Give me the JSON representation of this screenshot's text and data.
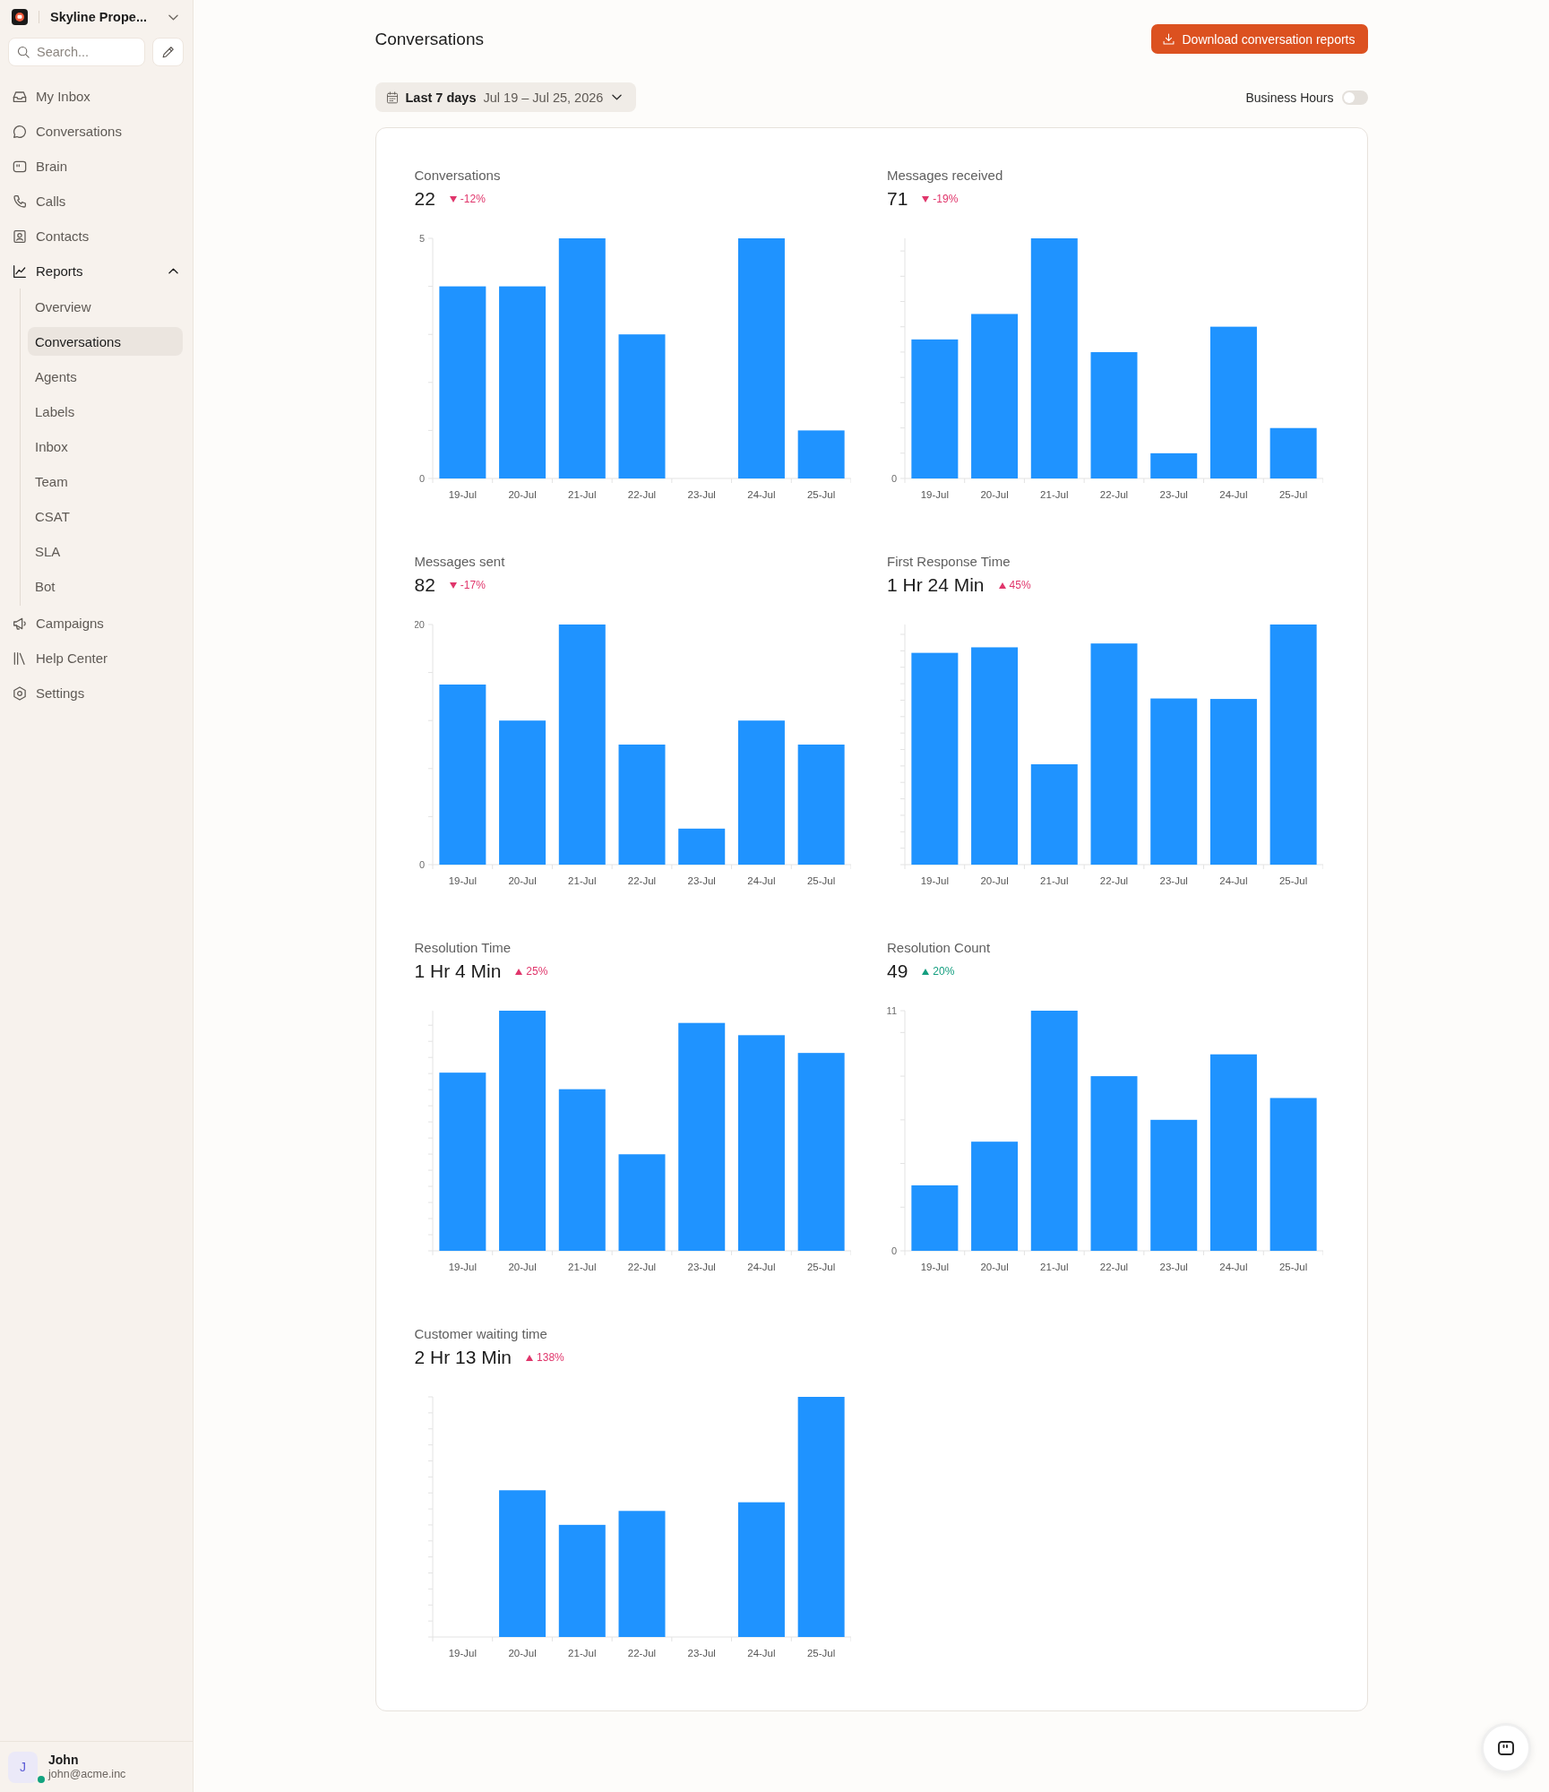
{
  "sidebar": {
    "workspace": "Skyline Prope...",
    "search": {
      "placeholder": "Search..."
    },
    "nav": [
      {
        "label": "My Inbox",
        "selected": false
      },
      {
        "label": "Conversations",
        "selected": false
      },
      {
        "label": "Brain",
        "selected": false
      },
      {
        "label": "Calls",
        "selected": false
      },
      {
        "label": "Contacts",
        "selected": false
      },
      {
        "label": "Reports",
        "selected": false,
        "expanded": true,
        "children": [
          {
            "label": "Overview",
            "selected": false
          },
          {
            "label": "Conversations",
            "selected": true
          },
          {
            "label": "Agents",
            "selected": false
          },
          {
            "label": "Labels",
            "selected": false
          },
          {
            "label": "Inbox",
            "selected": false
          },
          {
            "label": "Team",
            "selected": false
          },
          {
            "label": "CSAT",
            "selected": false
          },
          {
            "label": "SLA",
            "selected": false
          },
          {
            "label": "Bot",
            "selected": false
          }
        ]
      },
      {
        "label": "Campaigns",
        "selected": false
      },
      {
        "label": "Help Center",
        "selected": false
      },
      {
        "label": "Settings",
        "selected": false
      }
    ],
    "user": {
      "initial": "J",
      "name": "John",
      "email": "john@acme.inc",
      "online": true
    }
  },
  "header": {
    "title": "Conversations",
    "download_button": "Download conversation reports",
    "date_range": {
      "preset": "Last 7 days",
      "range": "Jul 19 – Jul 25, 2026"
    },
    "business_hours": {
      "label": "Business Hours",
      "on": false
    }
  },
  "metrics": [
    {
      "title": "Conversations",
      "value": "22",
      "change": "-12%",
      "increase": false,
      "favorable": false,
      "chart_data": {
        "type": "bar",
        "categories": [
          "19-Jul",
          "20-Jul",
          "21-Jul",
          "22-Jul",
          "23-Jul",
          "24-Jul",
          "25-Jul"
        ],
        "values": [
          4,
          4,
          5,
          3,
          0,
          5,
          1
        ],
        "ylim": [
          0,
          5
        ],
        "yticks": [
          0,
          5
        ]
      }
    },
    {
      "title": "Messages received",
      "value": "71",
      "change": "-19%",
      "increase": false,
      "favorable": false,
      "chart": {
        "x_labels": [
          "19-Jul",
          "20-Jul",
          "21-Jul",
          "22-Jul",
          "23-Jul",
          "24-Jul",
          "25-Jul"
        ],
        "y_labels": [
          "0"
        ]
      }
    },
    {
      "title": "Messages sent",
      "value": "82",
      "change": "-17%",
      "increase": false,
      "favorable": false,
      "chart_data": {
        "type": "bar",
        "categories": [
          "19-Jul",
          "20-Jul",
          "21-Jul",
          "22-Jul",
          "23-Jul",
          "24-Jul",
          "25-Jul"
        ],
        "values": [
          15,
          12,
          20,
          10,
          3,
          12,
          10
        ],
        "ylim": [
          0,
          20
        ],
        "yticks": [
          0,
          20
        ]
      }
    },
    {
      "title": "First Response Time",
      "value": "1 Hr 24 Min",
      "change": "45%",
      "increase": true,
      "favorable": false,
      "chart": {
        "x_labels": [
          "19-Jul",
          "20-Jul",
          "21-Jul",
          "22-Jul",
          "23-Jul",
          "24-Jul",
          "25-Jul"
        ]
      }
    },
    {
      "title": "Resolution Time",
      "value": "1 Hr 4 Min",
      "change": "25%",
      "increase": true,
      "favorable": false,
      "chart": {
        "x_labels": [
          "19-Jul",
          "20-Jul",
          "21-Jul",
          "22-Jul",
          "23-Jul",
          "24-Jul",
          "25-Jul"
        ]
      }
    },
    {
      "title": "Resolution Count",
      "value": "49",
      "change": "20%",
      "increase": true,
      "favorable": true,
      "chart_data": {
        "type": "bar",
        "categories": [
          "19-Jul",
          "20-Jul",
          "21-Jul",
          "22-Jul",
          "23-Jul",
          "24-Jul",
          "25-Jul"
        ],
        "values": [
          3,
          5,
          11,
          8,
          6,
          9,
          7
        ],
        "ylim": [
          0,
          11
        ],
        "yticks": [
          0,
          11
        ]
      }
    },
    {
      "title": "Customer waiting time",
      "value": "2 Hr 13 Min",
      "change": "138%",
      "increase": true,
      "favorable": false,
      "chart": {
        "x_labels": [
          "19-Jul",
          "20-Jul",
          "21-Jul",
          "22-Jul",
          "23-Jul",
          "24-Jul",
          "25-Jul"
        ]
      }
    }
  ]
}
